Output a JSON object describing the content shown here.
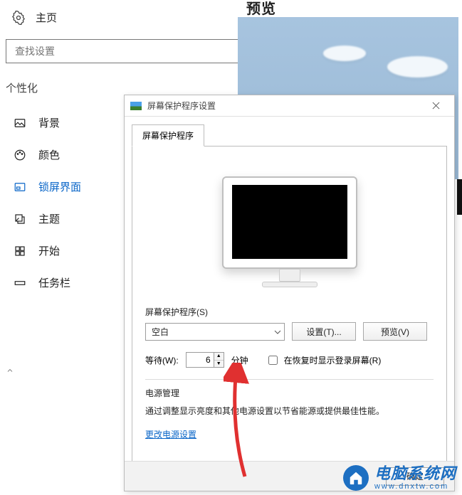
{
  "settings": {
    "home_label": "主页",
    "search_placeholder": "查找设置",
    "section_header": "个性化",
    "items": [
      {
        "label": "背景"
      },
      {
        "label": "颜色"
      },
      {
        "label": "锁屏界面"
      },
      {
        "label": "主题"
      },
      {
        "label": "开始"
      },
      {
        "label": "任务栏"
      }
    ],
    "preview_title": "预览"
  },
  "dialog": {
    "title": "屏幕保护程序设置",
    "tab_label": "屏幕保护程序",
    "screensaver_section_label": "屏幕保护程序(S)",
    "combo_value": "空白",
    "settings_button": "设置(T)...",
    "preview_button": "预览(V)",
    "wait_label": "等待(W):",
    "wait_value": "6",
    "wait_unit": "分钟",
    "resume_checkbox_label": "在恢复时显示登录屏幕(R)",
    "resume_checked": false,
    "power_section_label": "电源管理",
    "power_desc": "通过调整显示亮度和其他电源设置以节省能源或提供最佳性能。",
    "power_link": "更改电源设置",
    "ok_button": "确定"
  },
  "watermark": {
    "title": "电脑系统网",
    "url": "www.dnxtw.com"
  }
}
